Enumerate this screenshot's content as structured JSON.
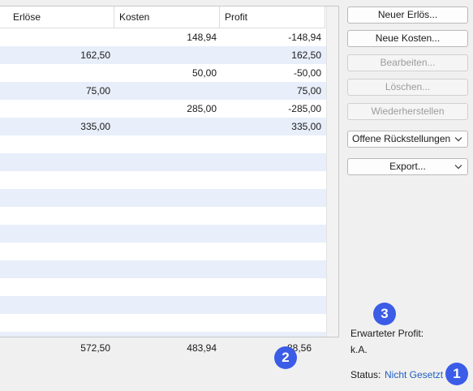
{
  "table": {
    "columns": [
      "Erlöse",
      "Kosten",
      "Profit"
    ],
    "rows": [
      {
        "erloese": "",
        "kosten": "148,94",
        "profit": "-148,94"
      },
      {
        "erloese": "162,50",
        "kosten": "",
        "profit": "162,50"
      },
      {
        "erloese": "",
        "kosten": "50,00",
        "profit": "-50,00"
      },
      {
        "erloese": "75,00",
        "kosten": "",
        "profit": "75,00"
      },
      {
        "erloese": "",
        "kosten": "285,00",
        "profit": "-285,00"
      },
      {
        "erloese": "335,00",
        "kosten": "",
        "profit": "335,00"
      },
      {
        "erloese": "",
        "kosten": "",
        "profit": ""
      },
      {
        "erloese": "",
        "kosten": "",
        "profit": ""
      },
      {
        "erloese": "",
        "kosten": "",
        "profit": ""
      },
      {
        "erloese": "",
        "kosten": "",
        "profit": ""
      },
      {
        "erloese": "",
        "kosten": "",
        "profit": ""
      },
      {
        "erloese": "",
        "kosten": "",
        "profit": ""
      },
      {
        "erloese": "",
        "kosten": "",
        "profit": ""
      },
      {
        "erloese": "",
        "kosten": "",
        "profit": ""
      },
      {
        "erloese": "",
        "kosten": "",
        "profit": ""
      },
      {
        "erloese": "",
        "kosten": "",
        "profit": ""
      },
      {
        "erloese": "",
        "kosten": "",
        "profit": ""
      },
      {
        "erloese": "",
        "kosten": "",
        "profit": ""
      }
    ],
    "totals": {
      "erloese": "572,50",
      "kosten": "483,94",
      "profit": "88,56"
    }
  },
  "buttons": {
    "new_revenue": "Neuer Erlös...",
    "new_cost": "Neue Kosten...",
    "edit": "Bearbeiten...",
    "delete": "Löschen...",
    "restore": "Wiederherstellen",
    "open_provisions": "Offene Rückstellungen",
    "export": "Export..."
  },
  "summary": {
    "expected_profit_label": "Erwarteter Profit:",
    "expected_profit_value": "k.A.",
    "status_label": "Status:",
    "status_value": "Nicht Gesetzt"
  },
  "badges": [
    "1",
    "2",
    "3"
  ],
  "colors": {
    "row_alt": "#e8eefa",
    "link": "#1f5fbf",
    "badge": "#3b5ce6"
  },
  "icons": [
    "chevron-down-icon"
  ]
}
